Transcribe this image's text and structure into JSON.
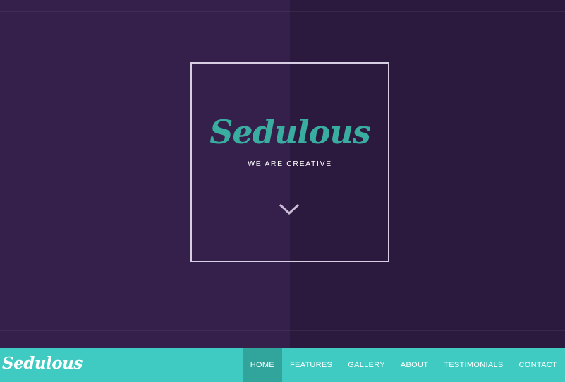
{
  "colors": {
    "hero_left": "#35204b",
    "hero_right": "#2c1a3e",
    "frame": "#d9cfe4",
    "brand_teal": "#3aada1",
    "tagline": "#ffffff",
    "chevron": "#c9bcd6",
    "nav_bg": "#3fcbc2",
    "nav_active_bg": "#31a59b",
    "nav_text": "#ffffff"
  },
  "hero": {
    "title": "Sedulous",
    "tagline": "WE ARE CREATIVE",
    "scroll_icon": "chevron-down-icon"
  },
  "navbar": {
    "logo": "Sedulous",
    "items": [
      {
        "label": "HOME",
        "active": true
      },
      {
        "label": "FEATURES",
        "active": false
      },
      {
        "label": "GALLERY",
        "active": false
      },
      {
        "label": "ABOUT",
        "active": false
      },
      {
        "label": "TESTIMONIALS",
        "active": false
      },
      {
        "label": "CONTACT",
        "active": false
      }
    ]
  }
}
